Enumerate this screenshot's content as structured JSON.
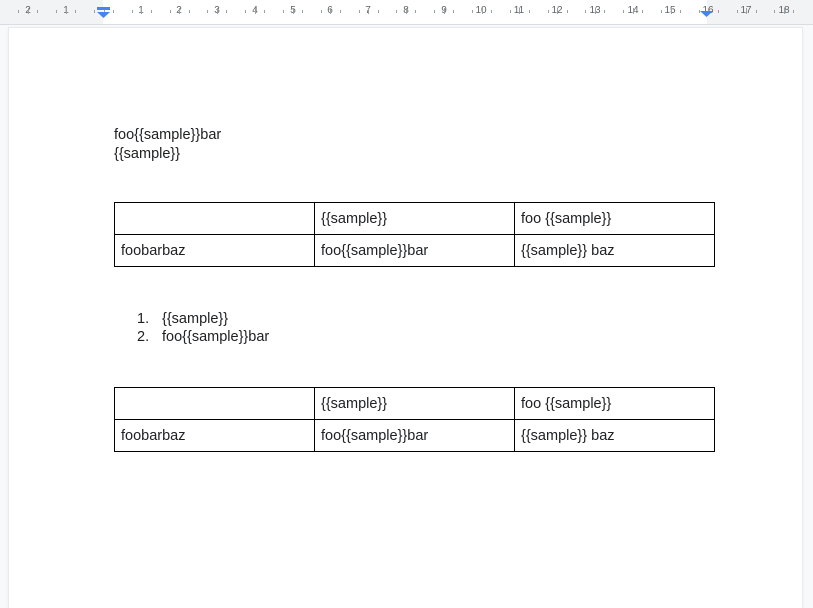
{
  "ruler": {
    "numbers": [
      "2",
      "1",
      "1",
      "2",
      "3",
      "4",
      "5",
      "6",
      "7",
      "8",
      "9",
      "10",
      "11",
      "12",
      "13",
      "14",
      "15",
      "16",
      "17",
      "18"
    ]
  },
  "document": {
    "lines": [
      "foo{{sample}}bar",
      "{{sample}}"
    ],
    "table1": [
      [
        "",
        "{{sample}}",
        "foo {{sample}}"
      ],
      [
        "foobarbaz",
        "foo{{sample}}bar",
        "{{sample}} baz"
      ]
    ],
    "list": [
      {
        "num": "1.",
        "text": "{{sample}}"
      },
      {
        "num": "2.",
        "text": "foo{{sample}}bar"
      }
    ],
    "table2": [
      [
        "",
        "{{sample}}",
        "foo {{sample}}"
      ],
      [
        "foobarbaz",
        "foo{{sample}}bar",
        "{{sample}} baz"
      ]
    ]
  },
  "colors": {
    "indent_marker": "#4285f4",
    "text": "#202124",
    "table_border": "#000000"
  }
}
